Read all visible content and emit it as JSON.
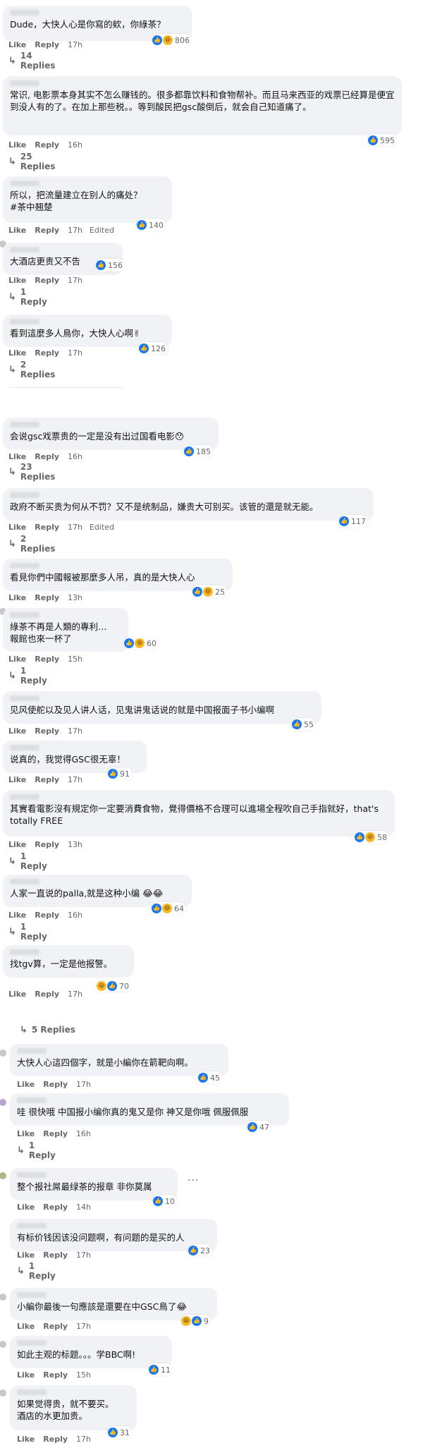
{
  "meta_labels": {
    "like": "Like",
    "reply": "Reply"
  },
  "comments": [
    {
      "text": "Dude，大快人心是你寫的欸，你綠茶？",
      "reactions": "806",
      "time": "17h",
      "replies": "14 Replies"
    },
    {
      "text": "常识, 电影票本身其实不怎么赚钱的。很多都靠饮料和食物帮补。而且马来西亚的戏票已经算是便宜到没人有的了。在加上那些税。。等到酸民把gsc酸倒后，就会自己知道痛了。",
      "reactions": "595",
      "time": "16h",
      "replies": "25 Replies"
    },
    {
      "text": "所以，把流量建立在别人的痛处？\n#茶中翘楚",
      "reactions": "140",
      "time": "17h",
      "edited": "Edited"
    },
    {
      "text": "大酒店更贵又不告",
      "reactions": "156",
      "time": "17h",
      "replies": "1 Reply"
    },
    {
      "text": "看到這麼多人鳥你，大快人心啊✌",
      "reactions": "126",
      "time": "17h",
      "replies": "2 Replies"
    },
    {
      "text": "会说gsc戏票贵的一定是没有出过国看电影😯",
      "reactions": "185",
      "time": "16h",
      "replies": "23 Replies"
    },
    {
      "text": "政府不断买贵为何从不罚？又不是统制品，嫌贵大可别买。该管的還是就无能。",
      "reactions": "117",
      "time": "17h",
      "edited": "Edited",
      "replies": "2 Replies"
    },
    {
      "text": "看見你們中國報被那麼多人吊，真的是大快人心",
      "reactions": "25",
      "time": "13h"
    },
    {
      "text": "綠茶不再是人類的專利…\n報館也來一杯了",
      "reactions": "60",
      "time": "15h",
      "replies": "1 Reply"
    },
    {
      "text": "见风使舵以及见人讲人话，见鬼讲鬼话说的就是中国报面子书小编啊",
      "reactions": "55",
      "time": "17h"
    },
    {
      "text": "说真的，我觉得GSC很无辜！",
      "reactions": "91",
      "time": "17h"
    },
    {
      "text": "其實看電影沒有規定你一定要消費食物，覺得價格不合理可以進場全程吹自己手指就好，that's totally FREE",
      "reactions": "58",
      "time": "13h",
      "replies": "1 Reply"
    },
    {
      "text": "人家一直说的palla,就是这种小编 😂😂",
      "reactions": "64",
      "time": "16h",
      "replies": "1 Reply"
    },
    {
      "text": "找tgv算，一定是他报警。",
      "reactions": "70",
      "time": "17h"
    },
    {
      "text": "大快人心這四個字，就是小編你在箭靶向啊。",
      "reactions": "45",
      "time": "17h"
    },
    {
      "text": "哇 很快哦 中国报小编你真的鬼又是你 神又是你哦 佩服佩服",
      "reactions": "47",
      "time": "16h",
      "replies": "1 Reply"
    },
    {
      "text": "整个报社屌最绿茶的报章 非你莫属",
      "reactions": "10",
      "time": "14h"
    },
    {
      "text": "有标价钱因该没问题啊，有问题的是买的人",
      "reactions": "23",
      "time": "17h",
      "replies": "1 Reply"
    },
    {
      "text": "小編你最後一句應該是還要在中GSC鳥了😂",
      "reactions": "9",
      "time": "17h"
    },
    {
      "text": "如此主观的标题。。。学BBC啊!",
      "reactions": "11",
      "time": "15h"
    },
    {
      "text": "如果觉得贵，就不要买。\n酒店的水更加贵。",
      "reactions": "31",
      "time": "17h"
    }
  ],
  "hidden_replies": "5 Replies",
  "more_options": "···",
  "reaction_icons": [
    "like",
    "haha",
    "love"
  ]
}
